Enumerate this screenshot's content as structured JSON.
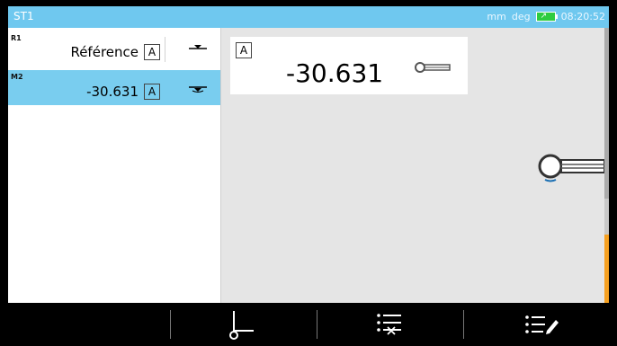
{
  "titlebar": {
    "title": "ST1",
    "units": "mm",
    "angle_units": "deg",
    "time": "08:20:52",
    "battery_color": "#2ecc40"
  },
  "features": [
    {
      "tag": "R1",
      "label": "Référence",
      "datum": "A"
    },
    {
      "tag": "M2",
      "label": "-30.631",
      "datum": "A",
      "selected": true
    }
  ],
  "display": {
    "datum": "A",
    "value": "-30.631"
  },
  "toolbar": {
    "buttons": [
      "set-origin",
      "delete-list",
      "edit-list"
    ]
  },
  "colors": {
    "accent": "#79cdef",
    "titlebar": "#6fc8ef",
    "highlight": "#f5a021"
  }
}
